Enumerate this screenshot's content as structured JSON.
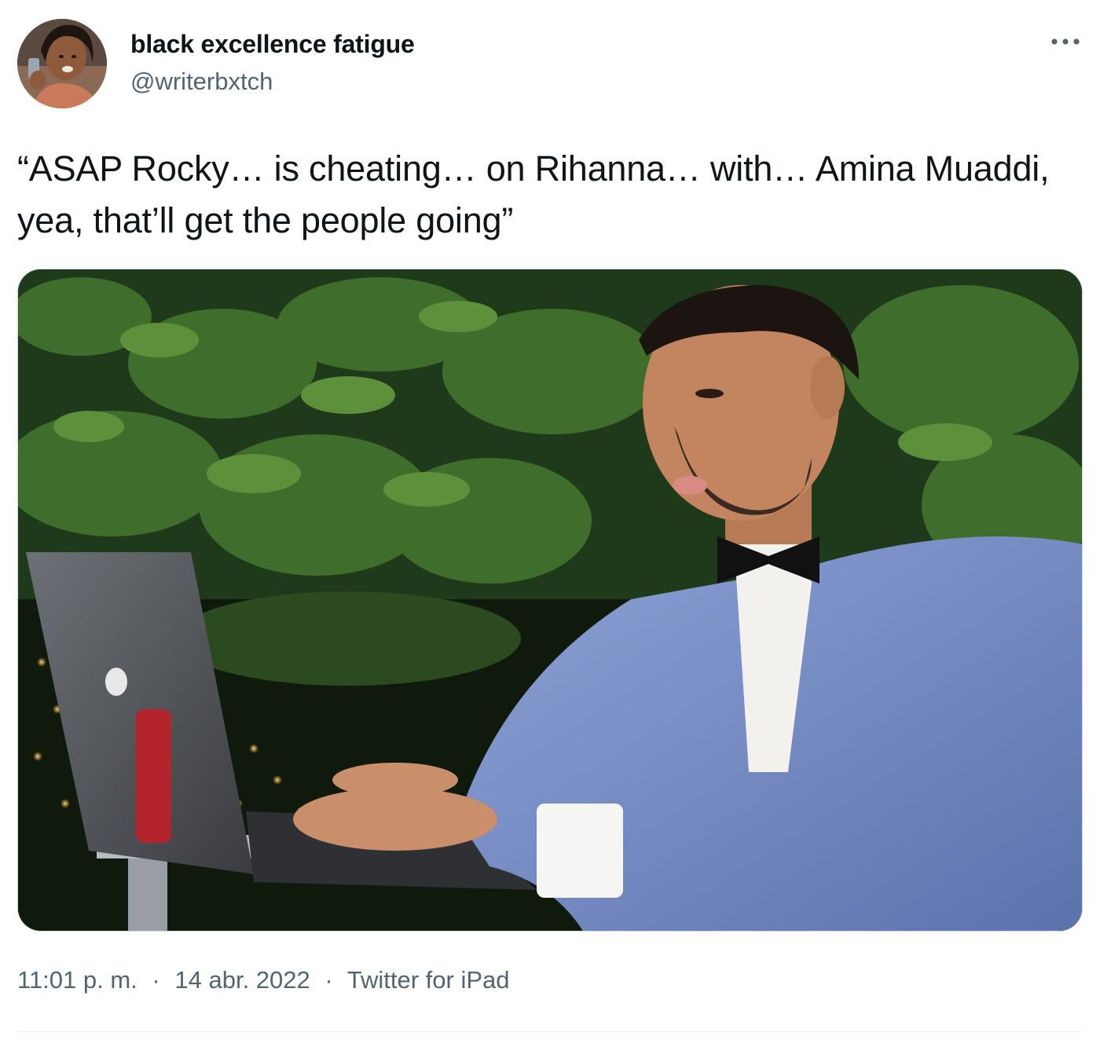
{
  "author": {
    "display_name": "black excellence fatigue",
    "handle": "@writerbxtch",
    "avatar_icon": "profile-avatar"
  },
  "menu": {
    "icon": "more-horizontal-icon",
    "glyph": "•••"
  },
  "tweet": {
    "text": "“ASAP Rocky… is cheating… on Rihanna… with… Amina Muaddi, yea, that’ll get the people going”"
  },
  "media": {
    "kind": "photo",
    "icon": "man-in-blue-suit-at-laptop"
  },
  "meta": {
    "time": "11:01 p. m.",
    "date": "14 abr. 2022",
    "source": "Twitter for iPad",
    "separator": "·"
  },
  "colors": {
    "text_primary": "#0f1419",
    "text_secondary": "#536471",
    "border": "#cfd9de"
  }
}
